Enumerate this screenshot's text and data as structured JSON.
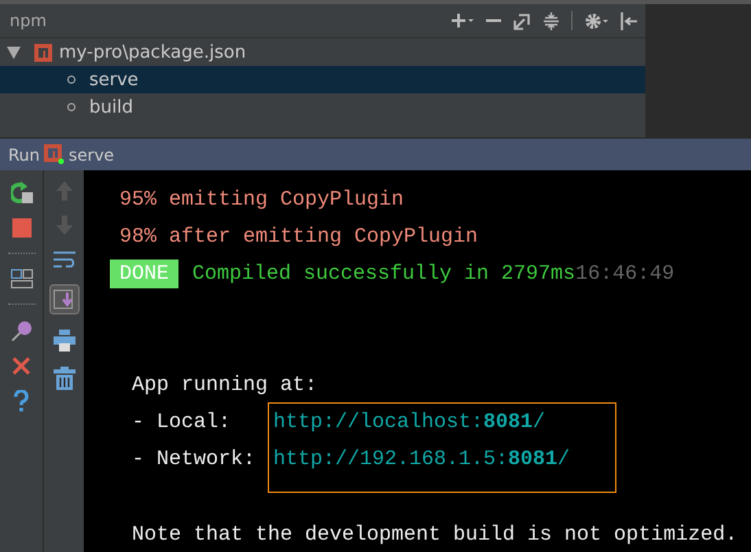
{
  "npm_panel": {
    "title": "npm",
    "tree": [
      {
        "label": "my-pro\\package.json",
        "expanded": true,
        "children": [
          {
            "label": "serve",
            "selected": true
          },
          {
            "label": "build",
            "selected": false
          }
        ]
      }
    ]
  },
  "run_bar": {
    "label": "Run",
    "config": "serve"
  },
  "console": {
    "lines": [
      {
        "kind": "progress",
        "text": "95% emitting CopyPlugin"
      },
      {
        "kind": "progress",
        "text": "98% after emitting CopyPlugin"
      },
      {
        "kind": "done",
        "badge": "DONE",
        "text": "Compiled successfully in 2797ms",
        "time": "16:46:49"
      },
      {
        "kind": "blank"
      },
      {
        "kind": "blank"
      },
      {
        "kind": "plain",
        "text": "App running at:"
      }
    ],
    "urls": {
      "highlighted": true,
      "rows": [
        {
          "label": "- Local:",
          "url": "http://localhost:**8081**/"
        },
        {
          "label": "- Network:",
          "url": "http://192.168.1.5:**8081**/"
        }
      ]
    },
    "footer": "Note that the development build is not optimized."
  }
}
